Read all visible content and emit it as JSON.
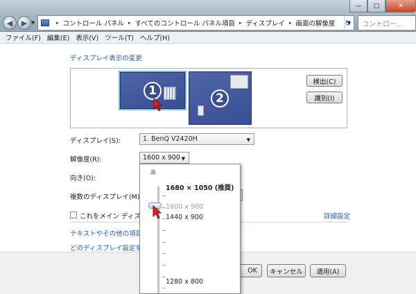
{
  "window": {
    "minimize_glyph": "—",
    "maximize_glyph": "□",
    "close_glyph": "✕"
  },
  "address": {
    "crumbs": [
      "コントロール パネル",
      "すべてのコントロール パネル項目",
      "ディスプレイ",
      "画面の解像度"
    ],
    "separator": "▸"
  },
  "search": {
    "placeholder": "コントロー..."
  },
  "menu": [
    "ファイル(F)",
    "編集(E)",
    "表示(V)",
    "ツール(T)",
    "ヘルプ(H)"
  ],
  "heading": "ディスプレイ表示の変更",
  "monitors": {
    "one": "1",
    "two": "2"
  },
  "buttons": {
    "detect": "検出(C)",
    "identify": "識別(I)",
    "ok": "OK",
    "cancel": "キャンセル",
    "apply": "適用(A)"
  },
  "labels": {
    "display": "ディスプレイ(S):",
    "resolution": "解像度(R):",
    "orientation": "向き(O):",
    "multiple": "複数のディスプレイ(M):"
  },
  "values": {
    "display": "1. BenQ V2420H",
    "resolution": "1600 x 900"
  },
  "checkbox_label": "これをメイン ディスプ",
  "links": {
    "advanced": "詳細設定",
    "text_size": "テキストやその他の項目の",
    "which_settings": "どのディスプレイ設定を選"
  },
  "popup": {
    "high": "高",
    "recommended": "1680 × 1050 (推奨)",
    "current": "1600 x 900",
    "option_1440": "1440 x 900",
    "option_1280": "1280 x 800",
    "current_fraction": 0.9
  }
}
